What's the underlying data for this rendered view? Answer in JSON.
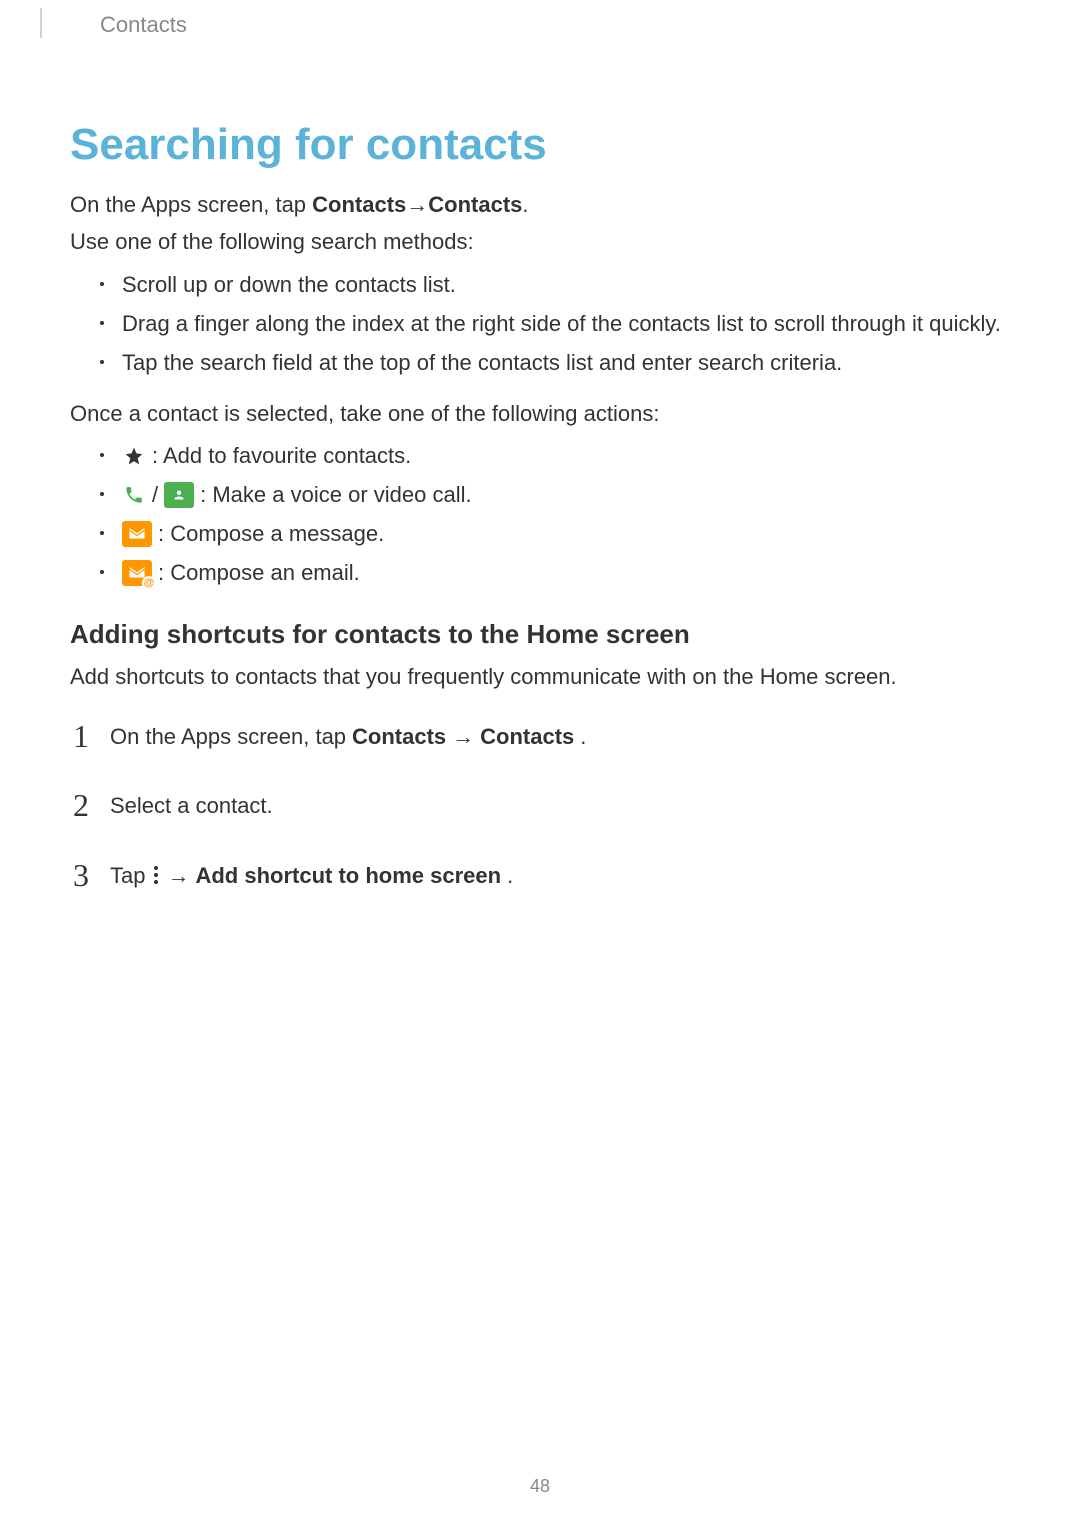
{
  "breadcrumb": "Contacts",
  "title": "Searching for contacts",
  "intro": {
    "part1": "On the Apps screen, tap ",
    "bold1": "Contacts",
    "arrow": " → ",
    "bold2": "Contacts",
    "period": ".",
    "line2": "Use one of the following search methods:"
  },
  "bullets1": [
    "Scroll up or down the contacts list.",
    "Drag a finger along the index at the right side of the contacts list to scroll through it quickly.",
    "Tap the search field at the top of the contacts list and enter search criteria."
  ],
  "actionsIntro": "Once a contact is selected, take one of the following actions:",
  "iconBullets": {
    "favourite": " : Add to favourite contacts.",
    "callSep": " / ",
    "call": " : Make a voice or video call.",
    "message": " : Compose a message.",
    "email": " : Compose an email."
  },
  "subheading": "Adding shortcuts for contacts to the Home screen",
  "subIntro": "Add shortcuts to contacts that you frequently communicate with on the Home screen.",
  "steps": {
    "s1": {
      "part1": "On the Apps screen, tap ",
      "bold1": "Contacts",
      "arrow": " → ",
      "bold2": "Contacts",
      "period": "."
    },
    "s2": "Select a contact.",
    "s3": {
      "part1": "Tap ",
      "arrow": " → ",
      "bold1": "Add shortcut to home screen",
      "period": "."
    }
  },
  "pageNumber": "48"
}
